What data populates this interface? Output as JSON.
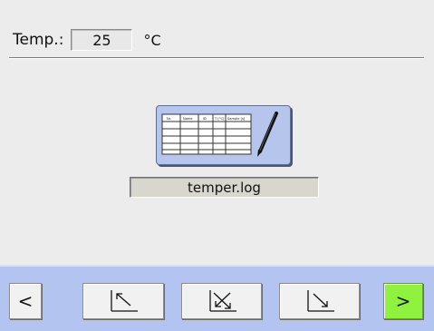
{
  "temperature": {
    "label": "Temp.:",
    "value": "25",
    "unit": "°C"
  },
  "log": {
    "filename": "temper.log",
    "table_headers": [
      "Nr.",
      "Name",
      "ID",
      "T [°C]",
      "Sample [s]"
    ],
    "icon": "table-pen-icon"
  },
  "nav": {
    "prev_label": "<",
    "next_label": ">",
    "buttons": [
      {
        "icon": "arrow-up-left-icon"
      },
      {
        "icon": "crossed-arrows-icon"
      },
      {
        "icon": "arrow-down-right-icon"
      }
    ],
    "next_color": "#8ff23e",
    "bar_color": "#b2c4ef"
  }
}
